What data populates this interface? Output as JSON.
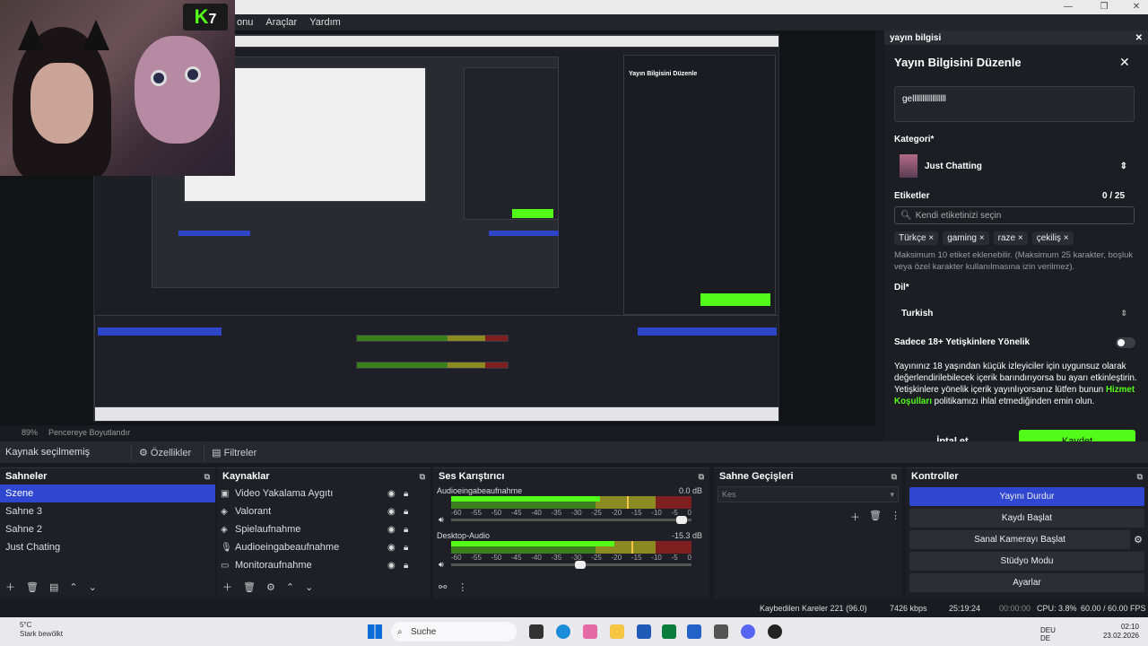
{
  "menu": [
    "onu",
    "Araçlar",
    "Yardım"
  ],
  "window_controls": [
    "—",
    "❐",
    "✕"
  ],
  "kick_logo": "K",
  "kick_mark": "7",
  "preview_status": {
    "zoom": "89%",
    "mode": "Pencereye Boyutlandır"
  },
  "sources_bar": {
    "label": "Kaynak seçilmemiş",
    "properties": "Özellikler",
    "filters": "Filtreler"
  },
  "scenes": {
    "title": "Sahneler",
    "items": [
      "Szene",
      "Sahne 3",
      "Sahne 2",
      "Just Chating"
    ],
    "selected": 0
  },
  "sources": {
    "title": "Kaynaklar",
    "items": [
      "Video Yakalama Aygıtı",
      "Valorant",
      "Spielaufnahme",
      "Audioeingabeaufnahme",
      "Monitoraufnahme"
    ]
  },
  "mixer": {
    "title": "Ses Karıştırıcı",
    "channels": [
      {
        "name": "Audioeingabeaufnahme",
        "db": "0.0 dB",
        "level": 0.62,
        "peak": 0.73,
        "volume": 0.98
      },
      {
        "name": "Desktop-Audio",
        "db": "-15.3 dB",
        "level": 0.68,
        "peak": 0.75,
        "volume": 0.56
      }
    ],
    "scale": [
      "-60",
      "-55",
      "-50",
      "-45",
      "-40",
      "-35",
      "-30",
      "-25",
      "-20",
      "-15",
      "-10",
      "-5",
      "0"
    ]
  },
  "transitions": {
    "title": "Sahne Geçişleri",
    "value": "Kes"
  },
  "controls": {
    "title": "Kontroller",
    "buttons": [
      "Yayını Durdur",
      "Kaydı Başlat",
      "Sanal Kamerayı Başlat",
      "Stüdyo Modu",
      "Ayarlar"
    ]
  },
  "stream_panel": {
    "dock_title": "yayın bilgisi",
    "title": "Yayın Bilgisini Düzenle",
    "stream_title_value": "gelllllllllllllllll",
    "category_label": "Kategori*",
    "category_value": "Just Chatting",
    "tags_label": "Etiketler",
    "tags_count": "0 / 25",
    "tags_placeholder": "Kendi etiketinizi seçin",
    "tags": [
      "Türkçe ×",
      "gaming ×",
      "raze ×",
      "çekiliş ×"
    ],
    "tags_hint": "Maksimum 10 etiket eklenebilir. (Maksimum 25 karakter, boşluk veya özel karakter kullanılmasına izin verilmez).",
    "language_label": "Dil*",
    "language_value": "Turkish",
    "adult_label": "Sadece 18+ Yetişkinlere Yönelik",
    "adult_text_before": "Yayınınız 18 yaşından küçük izleyiciler için uygunsuz olarak değerlendirilebilecek içerik barındırıyorsa bu ayarı etkinleştirin. Yetişkinlere yönelik içerik yayınlıyorsanız lütfen bunun ",
    "adult_link": "Hizmet Koşulları",
    "adult_text_after": " politikamızı ihlal etmediğinden emin olun.",
    "cancel": "İptal et",
    "save": "Kaydet"
  },
  "stats": {
    "dropped": "Kaybedilen Kareler 221 (96.0)",
    "kbps": "7426 kbps",
    "live_time": "25:19:24",
    "rec_time": "00:00:00",
    "cpu": "CPU: 3.8%",
    "fps": "60.00 / 60.00 FPS"
  },
  "taskbar": {
    "weather_temp": "5°C",
    "weather_desc": "Stark bewölkt",
    "search": "Suche",
    "lang1": "DEU",
    "lang2": "DE",
    "time": "02:10",
    "date": "23.02.2026"
  }
}
